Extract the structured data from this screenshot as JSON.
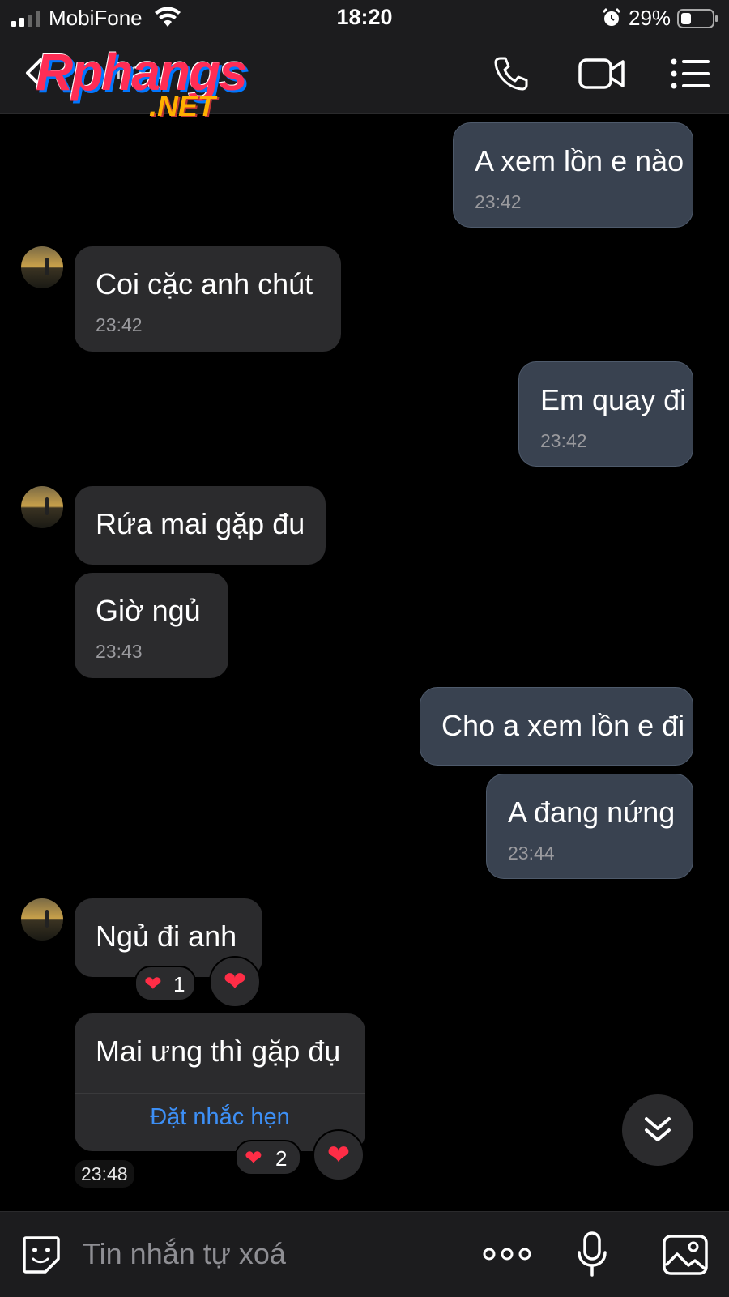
{
  "status_bar": {
    "carrier": "MobiFone",
    "time": "18:20",
    "battery_percent": "29%"
  },
  "header": {
    "contact_name_partial": "...ng...",
    "watermark_logo": "Rphangs",
    "watermark_sub": ".NET"
  },
  "messages": [
    {
      "side": "out",
      "text": "A xem lồn e nào",
      "time": "23:42"
    },
    {
      "side": "in",
      "text": "Coi cặc anh chút",
      "time": "23:42"
    },
    {
      "side": "out",
      "text": "Em quay đi",
      "time": "23:42"
    },
    {
      "side": "in",
      "text": "Rứa mai gặp đu",
      "time": ""
    },
    {
      "side": "in",
      "text": "Giờ ngủ",
      "time": "23:43"
    },
    {
      "side": "out",
      "text": "Cho a xem lồn e đi",
      "time": ""
    },
    {
      "side": "out",
      "text": "A đang nứng",
      "time": "23:44"
    },
    {
      "side": "in",
      "text": "Ngủ đi anh",
      "time": "",
      "reaction_count": "1"
    },
    {
      "side": "in",
      "text": "Mai ưng thì gặp đụ",
      "time": "",
      "reaction_count": "2",
      "action": "Đặt nhắc hẹn"
    }
  ],
  "last_time_pill": "23:48",
  "input": {
    "placeholder": "Tin nhắn tự xoá"
  },
  "colors": {
    "background": "#000000",
    "outgoing_bubble": "#394250",
    "incoming_bubble": "#2b2b2d",
    "link_blue": "#3d8ff5",
    "heart_red": "#ff2d46"
  }
}
